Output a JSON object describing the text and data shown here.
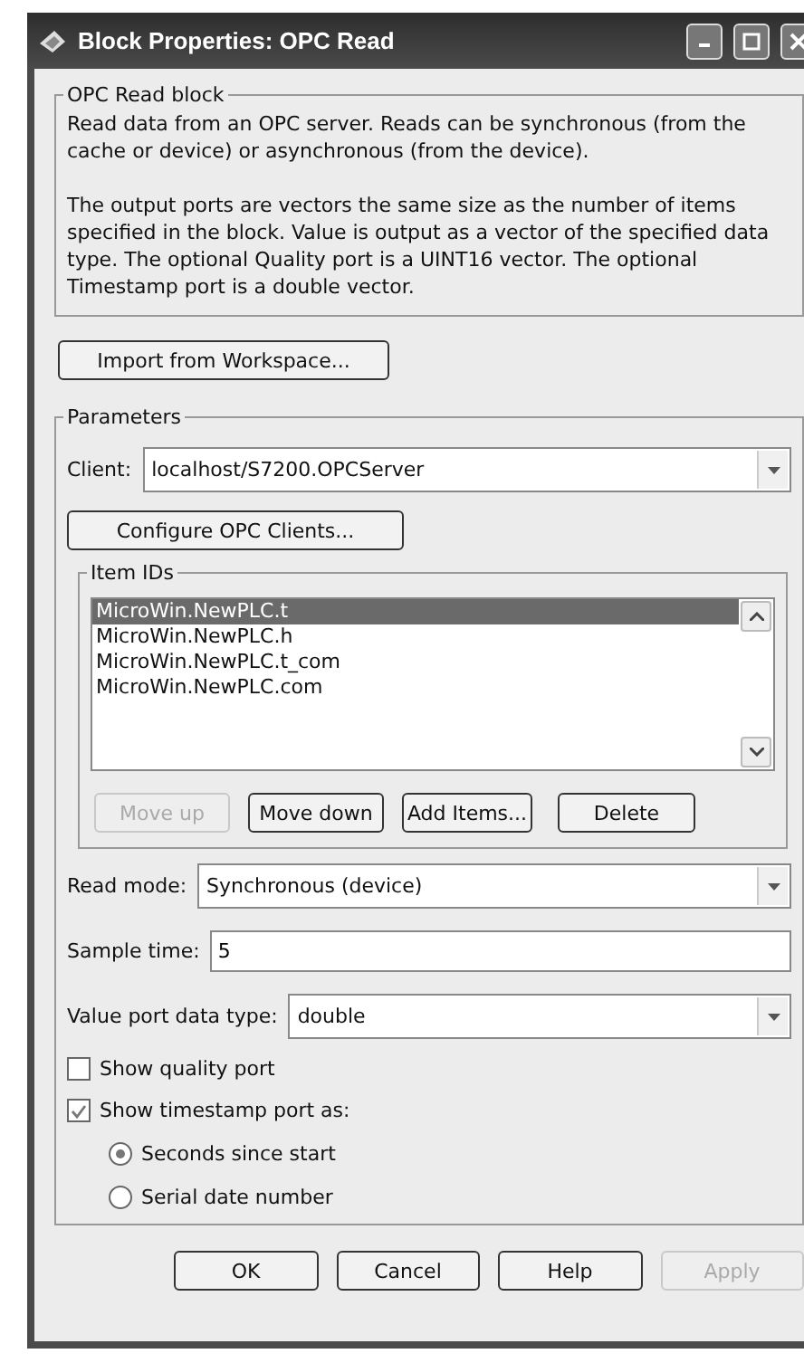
{
  "window": {
    "title": "Block Properties: OPC Read"
  },
  "description": {
    "title": "OPC Read block",
    "paragraphs": [
      "Read data from an OPC server. Reads can be synchronous (from the cache or device) or asynchronous (from the device).",
      "The output ports are vectors the same size as the number of items specified in the block. Value is output as a vector of the specified data type. The optional Quality port is a UINT16 vector. The optional Timestamp port is a double vector."
    ]
  },
  "import_button": {
    "label": "Import from Workspace...",
    "disabled": false
  },
  "parameters": {
    "title": "Parameters",
    "client": {
      "label": "Client:",
      "value": "localhost/S7200.OPCServer"
    },
    "configure_button": {
      "label": "Configure OPC Clients...",
      "disabled": false
    },
    "item_ids": {
      "title": "Item IDs",
      "items": [
        {
          "label": "MicroWin.NewPLC.t",
          "selected": true
        },
        {
          "label": "MicroWin.NewPLC.h",
          "selected": false
        },
        {
          "label": "MicroWin.NewPLC.t_com",
          "selected": false
        },
        {
          "label": "MicroWin.NewPLC.com",
          "selected": false
        }
      ],
      "buttons": [
        {
          "label": "Move up",
          "disabled": true
        },
        {
          "label": "Move down",
          "disabled": false
        },
        {
          "label": "Add Items...",
          "disabled": false
        },
        {
          "label": "Delete",
          "disabled": false
        }
      ]
    },
    "read_mode": {
      "label": "Read mode:",
      "value": "Synchronous (device)"
    },
    "sample_time": {
      "label": "Sample time:",
      "value": "5"
    },
    "value_port_data_type": {
      "label": "Value port data type:",
      "value": "double"
    },
    "checkboxes": [
      {
        "label": "Show quality port",
        "checked": false
      },
      {
        "label": "Show timestamp port as:",
        "checked": true
      }
    ],
    "radios": [
      {
        "label": "Seconds since start",
        "selected": true
      },
      {
        "label": "Serial date number",
        "selected": false
      }
    ]
  },
  "buttons": [
    {
      "label": "OK",
      "disabled": false
    },
    {
      "label": "Cancel",
      "disabled": false
    },
    {
      "label": "Help",
      "disabled": false
    },
    {
      "label": "Apply",
      "disabled": true
    }
  ]
}
